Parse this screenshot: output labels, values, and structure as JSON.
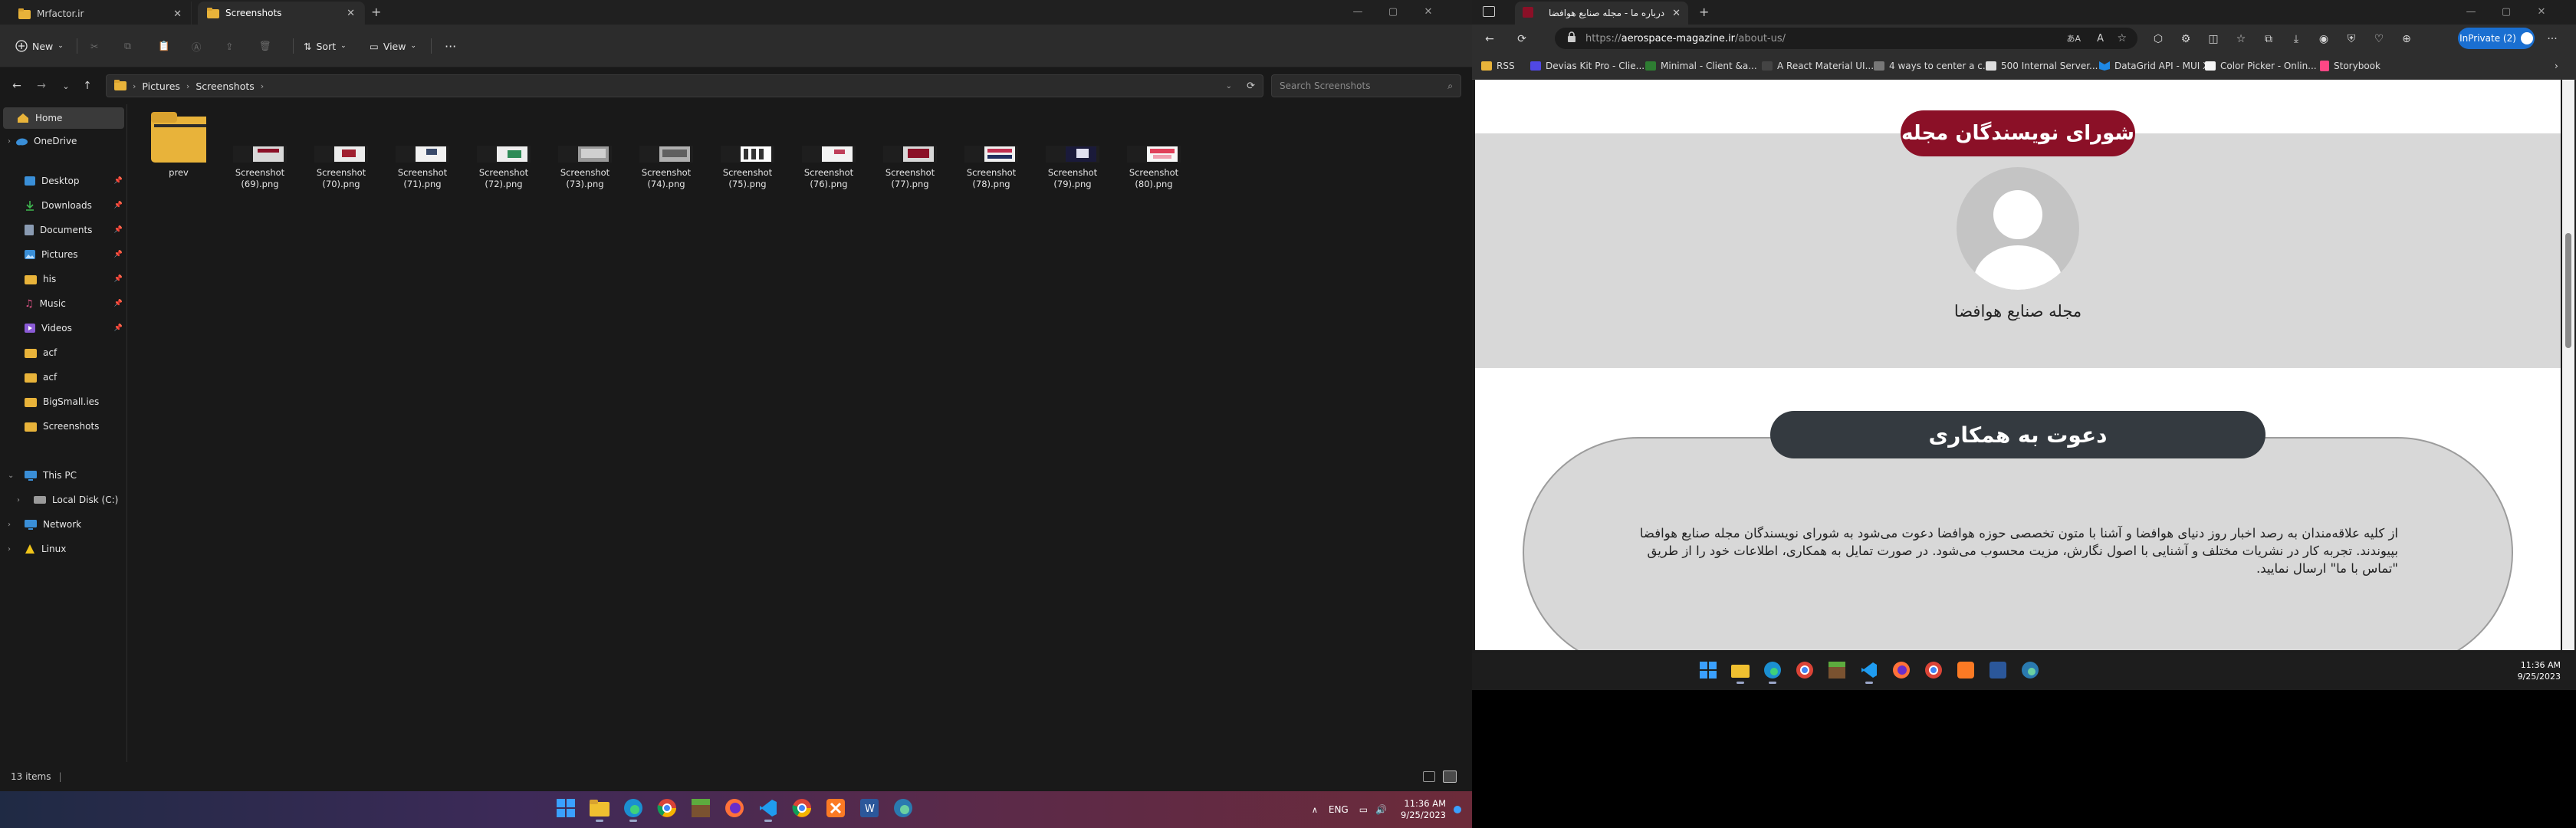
{
  "explorer": {
    "tabs": [
      {
        "label": "Mrfactor.ir",
        "active": false
      },
      {
        "label": "Screenshots",
        "active": true
      }
    ],
    "toolbar": {
      "new_label": "New",
      "sort_label": "Sort",
      "view_label": "View",
      "more_label": "···"
    },
    "breadcrumb": [
      "Pictures",
      "Screenshots"
    ],
    "search_placeholder": "Search Screenshots",
    "sidebar": {
      "home": "Home",
      "onedrive": "OneDrive",
      "pinned": [
        "Desktop",
        "Downloads",
        "Documents",
        "Pictures",
        "his",
        "Music",
        "Videos"
      ],
      "folders": [
        "acf",
        "acf",
        "BigSmall.ies",
        "Screenshots"
      ],
      "this_pc": "This PC",
      "local_disk": "Local Disk (C:)",
      "network": "Network",
      "linux": "Linux"
    },
    "files": [
      {
        "name": "prev",
        "kind": "folder"
      },
      {
        "name": "Screenshot (69).png"
      },
      {
        "name": "Screenshot (70).png"
      },
      {
        "name": "Screenshot (71).png"
      },
      {
        "name": "Screenshot (72).png"
      },
      {
        "name": "Screenshot (73).png"
      },
      {
        "name": "Screenshot (74).png"
      },
      {
        "name": "Screenshot (75).png"
      },
      {
        "name": "Screenshot (76).png"
      },
      {
        "name": "Screenshot (77).png"
      },
      {
        "name": "Screenshot (78).png"
      },
      {
        "name": "Screenshot (79).png"
      },
      {
        "name": "Screenshot (80).png"
      }
    ],
    "status": "13 items"
  },
  "taskbar_main": {
    "lang": "ENG",
    "time": "11:36 AM",
    "date": "9/25/2023"
  },
  "browser": {
    "tab_title": "درباره ما - مجله صنایع هوافضا",
    "url_prefix": "https://",
    "url_host": "aerospace-magazine.ir",
    "url_path": "/about-us/",
    "inprivate_label": "InPrivate (2)",
    "favorites": [
      "RSS",
      "Devias Kit Pro - Clie...",
      "Minimal - Client &a...",
      "A React Material UI...",
      "4 ways to center a c...",
      "500 Internal Server...",
      "DataGrid API - MUI X",
      "Color Picker - Onlin...",
      "Storybook"
    ]
  },
  "page": {
    "council_title": "شورای نویسندگان مجله",
    "avatar_name": "مجله صنایع هوافضا",
    "coop_title": "دعوت به همکاری",
    "coop_text": "از کلیه علاقه‌مندان به رصد اخبار روز دنیای هوافضا و آشنا با متون تخصصی حوزه هوافضا دعوت می‌شود به شورای نویسندگان مجله صنایع هوافضا بپیوندند. تجربه کار در نشریات مختلف و آشنایی با اصول نگارش، مزیت محسوب می‌شود. در صورت تمایل به همکاری، اطلاعات خود را از طریق \"تماس با ما\" ارسال نمایید."
  },
  "taskbar_browser": {
    "time": "11:36 AM",
    "date": "9/25/2023"
  },
  "colors": {
    "council_pill": "#8b1027",
    "coop_pill": "#343a40",
    "section_bg": "#d8d8d8",
    "inprivate": "#1a6fd1"
  }
}
